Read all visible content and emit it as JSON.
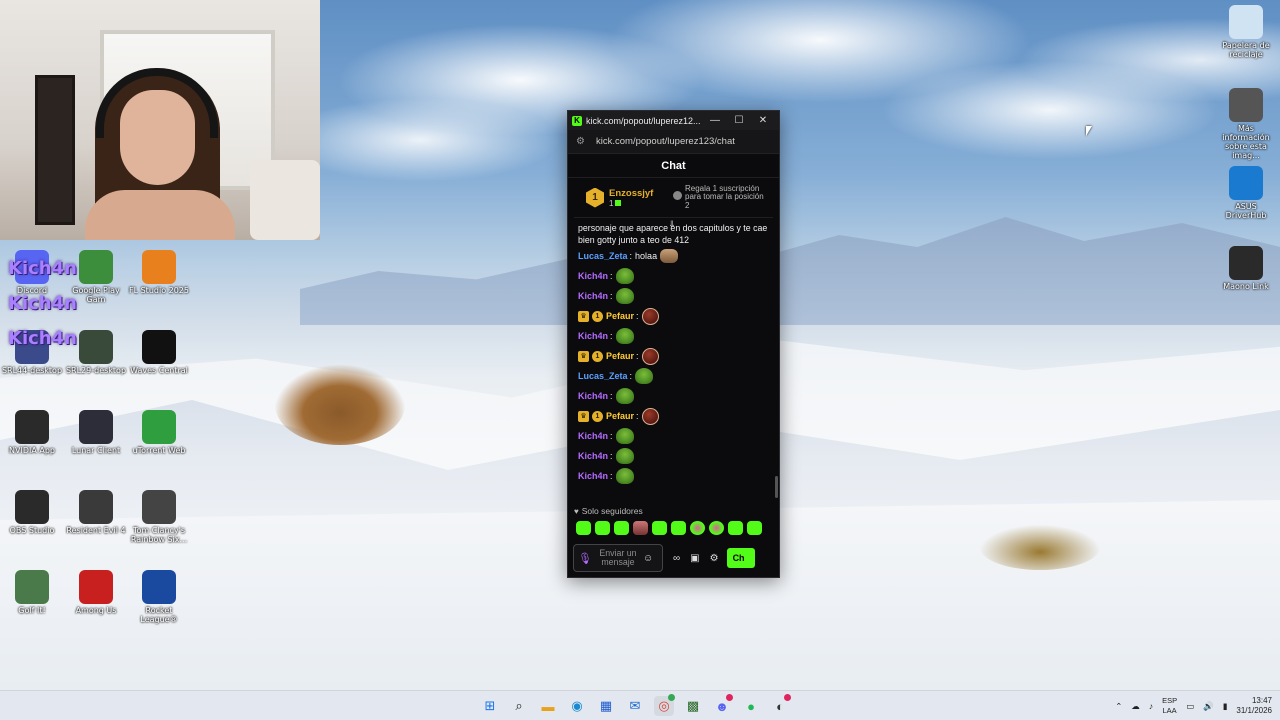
{
  "desktop": {
    "icons_left": [
      {
        "label": "Discord",
        "icon": "discord-icon",
        "color": "#5865f2"
      },
      {
        "label": "Google Play Gam",
        "icon": "google-play-games-icon",
        "color": "#3c8d3c"
      },
      {
        "label": "FL Studio 2025",
        "icon": "fl-studio-icon",
        "color": "#e8801e"
      },
      {
        "label": "SRL44-desktop",
        "icon": "app-shortcut-icon",
        "color": "#3a4a8a"
      },
      {
        "label": "SRL29-desktop",
        "icon": "app-shortcut-icon",
        "color": "#3a4a3a"
      },
      {
        "label": "Waves Central",
        "icon": "waves-central-icon",
        "color": "#111111"
      },
      {
        "label": "NVIDIA App",
        "icon": "nvidia-icon",
        "color": "#2a2a2a"
      },
      {
        "label": "Lunar Client",
        "icon": "lunar-client-icon",
        "color": "#2d2d3a"
      },
      {
        "label": "uTorrent Web",
        "icon": "utorrent-icon",
        "color": "#2e9e3e"
      },
      {
        "label": "OBS Studio",
        "icon": "obs-icon",
        "color": "#2a2a2a"
      },
      {
        "label": "Resident Evil 4",
        "icon": "resident-evil-icon",
        "color": "#3a3a3a"
      },
      {
        "label": "Tom Clancy's Rainbow Six...",
        "icon": "rainbow-six-icon",
        "color": "#444444"
      },
      {
        "label": "Golf It!",
        "icon": "golf-it-icon",
        "color": "#4a7a4a"
      },
      {
        "label": "Among Us",
        "icon": "among-us-icon",
        "color": "#c8201e"
      },
      {
        "label": "Rocket League®",
        "icon": "rocket-league-icon",
        "color": "#1a4aa0"
      }
    ],
    "icons_right": [
      {
        "label": "Papelera de reciclaje",
        "icon": "recycle-bin-icon",
        "color": "#cfe3f3"
      },
      {
        "label": "Más información sobre esta imag...",
        "icon": "spotlight-info-icon",
        "color": "#555555"
      },
      {
        "label": "ASUS DriverHub",
        "icon": "asus-driverhub-icon",
        "color": "#1a7ad0"
      },
      {
        "label": "Maono Link",
        "icon": "maono-link-icon",
        "color": "#2a2a2a"
      }
    ],
    "kich_tags": [
      "Kich4n",
      "Kich4n",
      "Kich4n"
    ]
  },
  "popout": {
    "window_title": "kick.com/popout/luperez12...",
    "url": "kick.com/popout/luperez123/chat",
    "chat_title": "Chat",
    "pinned": {
      "rank": "1",
      "name": "Enzossjyf",
      "count": "1",
      "gift_text": "Regala 1 suscripción para tomar la posición 2"
    },
    "partial_message": "personaje que aparece en dos capitulos y te cae bien gotty junto a teo de 412",
    "messages": [
      {
        "user": "Lucas_Zeta",
        "text": "holaa",
        "color": "blue",
        "emote": "cat"
      },
      {
        "user": "Kich4n",
        "text": "",
        "color": "purple",
        "emote": "pepe"
      },
      {
        "user": "Kich4n",
        "text": "",
        "color": "purple",
        "emote": "pepe"
      },
      {
        "user": "Pefaur",
        "text": "",
        "color": "yellow",
        "emote": "ball",
        "badges": true
      },
      {
        "user": "Kich4n",
        "text": "",
        "color": "purple",
        "emote": "pepe"
      },
      {
        "user": "Pefaur",
        "text": "",
        "color": "yellow",
        "emote": "ball",
        "badges": true
      },
      {
        "user": "Lucas_Zeta",
        "text": "",
        "color": "blue",
        "emote": "pepe"
      },
      {
        "user": "Kich4n",
        "text": "",
        "color": "purple",
        "emote": "pepe"
      },
      {
        "user": "Pefaur",
        "text": "",
        "color": "yellow",
        "emote": "ball",
        "badges": true
      },
      {
        "user": "Kich4n",
        "text": "",
        "color": "purple",
        "emote": "pepe"
      },
      {
        "user": "Kich4n",
        "text": "",
        "color": "purple",
        "emote": "pepe"
      },
      {
        "user": "Kich4n",
        "text": "",
        "color": "purple",
        "emote": "pepe"
      }
    ],
    "followers_only": "Solo seguidores",
    "input_placeholder": "Enviar un mensaje",
    "send_label": "Ch",
    "accent": "#53fc18"
  },
  "taskbar": {
    "lang_top": "ESP",
    "lang_bottom": "LAA",
    "time": "13:47",
    "date": "31/1/2026"
  }
}
